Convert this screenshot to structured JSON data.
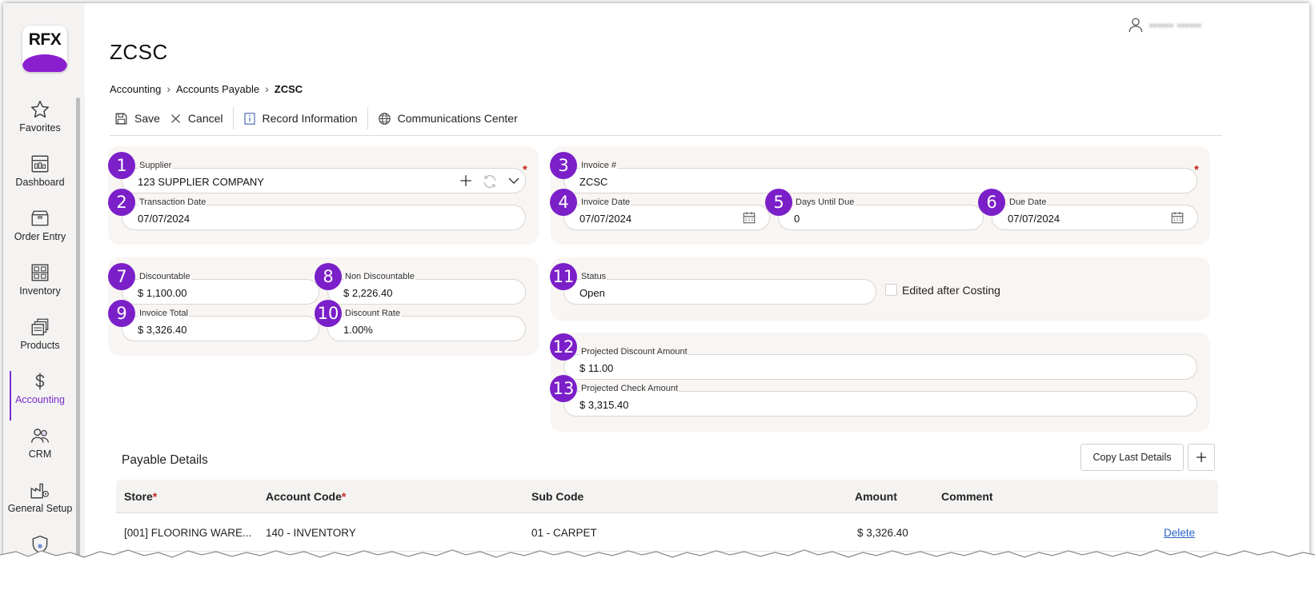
{
  "app": {
    "logo_text": "RFX"
  },
  "sidebar": {
    "items": [
      {
        "label": "Favorites",
        "icon": "star-icon"
      },
      {
        "label": "Dashboard",
        "icon": "dashboard-icon"
      },
      {
        "label": "Order Entry",
        "icon": "box-icon"
      },
      {
        "label": "Inventory",
        "icon": "shelves-icon"
      },
      {
        "label": "Products",
        "icon": "products-icon"
      },
      {
        "label": "Accounting",
        "icon": "dollar-icon",
        "active": true
      },
      {
        "label": "CRM",
        "icon": "people-icon"
      },
      {
        "label": "General Setup",
        "icon": "factory-gear-icon"
      }
    ]
  },
  "header": {
    "user_name": "▪▪▪▪▪▪ ▪▪▪▪▪▪"
  },
  "page": {
    "title": "ZCSC"
  },
  "breadcrumb": [
    "Accounting",
    "Accounts Payable",
    "ZCSC"
  ],
  "toolbar": {
    "save": "Save",
    "cancel": "Cancel",
    "record_information": "Record Information",
    "communications_center": "Communications Center"
  },
  "form": {
    "supplier": {
      "label": "Supplier",
      "value": "123 SUPPLIER COMPANY",
      "badge": "1"
    },
    "transaction_date": {
      "label": "Transaction Date",
      "value": "07/07/2024",
      "badge": "2"
    },
    "invoice_number": {
      "label": "Invoice #",
      "value": "ZCSC",
      "badge": "3"
    },
    "invoice_date": {
      "label": "Invoice Date",
      "value": "07/07/2024",
      "badge": "4"
    },
    "days_until_due": {
      "label": "Days Until Due",
      "value": "0",
      "badge": "5"
    },
    "due_date": {
      "label": "Due Date",
      "value": "07/07/2024",
      "badge": "6"
    },
    "discountable": {
      "label": "Discountable",
      "value": "$ 1,100.00",
      "badge": "7"
    },
    "non_discountable": {
      "label": "Non Discountable",
      "value": "$ 2,226.40",
      "badge": "8"
    },
    "invoice_total": {
      "label": "Invoice Total",
      "value": "$ 3,326.40",
      "badge": "9"
    },
    "discount_rate": {
      "label": "Discount Rate",
      "value": "1.00%",
      "badge": "10"
    },
    "status": {
      "label": "Status",
      "value": "Open",
      "badge": "11"
    },
    "edited_after_costing": {
      "label": "Edited after Costing",
      "checked": false
    },
    "projected_discount_amount": {
      "label": "Projected Discount Amount",
      "value": "$ 11.00",
      "badge": "12"
    },
    "projected_check_amount": {
      "label": "Projected Check Amount",
      "value": "$ 3,315.40",
      "badge": "13"
    }
  },
  "payable_details": {
    "title": "Payable Details",
    "copy_last_details": "Copy Last Details",
    "add_icon": "plus-icon",
    "columns": [
      "Store",
      "Account Code",
      "Sub Code",
      "Amount",
      "Comment"
    ],
    "rows": [
      {
        "store": "[001] FLOORING WARE...",
        "account_code": "140 - INVENTORY",
        "sub_code": "01 - CARPET",
        "amount": "$ 3,326.40",
        "comment": "",
        "action": "Delete"
      }
    ]
  },
  "colors": {
    "accent": "#7b1fc9",
    "required": "#c4271f",
    "panel": "#f8f5f3",
    "link": "#2b63c6"
  }
}
